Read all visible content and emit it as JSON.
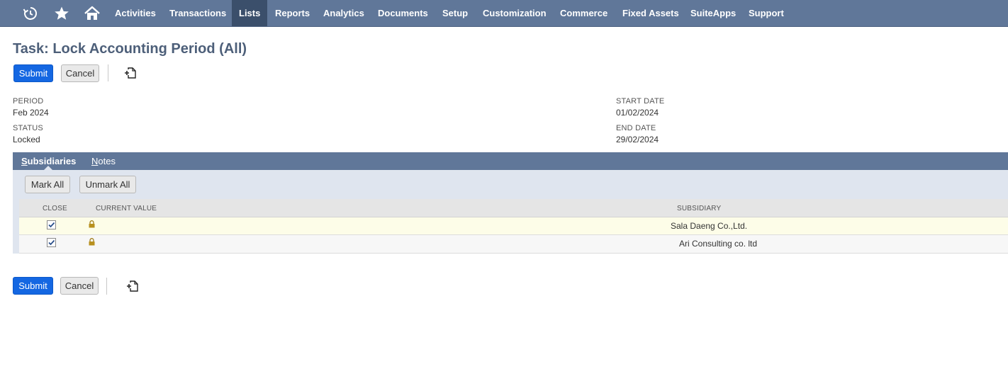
{
  "nav": {
    "items": [
      {
        "label": "Activities",
        "active": false
      },
      {
        "label": "Transactions",
        "active": false
      },
      {
        "label": "Lists",
        "active": true
      },
      {
        "label": "Reports",
        "active": false
      },
      {
        "label": "Analytics",
        "active": false
      },
      {
        "label": "Documents",
        "active": false
      },
      {
        "label": "Setup",
        "active": false
      },
      {
        "label": "Customization",
        "active": false
      },
      {
        "label": "Commerce",
        "active": false
      },
      {
        "label": "Fixed Assets",
        "active": false
      },
      {
        "label": "SuiteApps",
        "active": false
      },
      {
        "label": "Support",
        "active": false
      }
    ],
    "icons": [
      "recent-records-icon",
      "star-icon",
      "home-icon"
    ]
  },
  "page": {
    "title": "Task: Lock Accounting Period (All)"
  },
  "actions": {
    "submit_label": "Submit",
    "cancel_label": "Cancel"
  },
  "fields": {
    "period_label": "PERIOD",
    "period_value": "Feb 2024",
    "status_label": "STATUS",
    "status_value": "Locked",
    "start_date_label": "START DATE",
    "start_date_value": "01/02/2024",
    "end_date_label": "END DATE",
    "end_date_value": "29/02/2024"
  },
  "tabs": {
    "subsidiaries": {
      "underlined": "S",
      "rest": "ubsidiaries"
    },
    "notes": {
      "underlined": "N",
      "rest": "otes"
    }
  },
  "sublist": {
    "mark_all_label": "Mark All",
    "unmark_all_label": "Unmark All",
    "columns": [
      "CLOSE",
      "CURRENT VALUE",
      "SUBSIDIARY"
    ],
    "rows": [
      {
        "close": true,
        "current_value_locked": true,
        "subsidiary": "Sala Daeng Co.,Ltd."
      },
      {
        "close": true,
        "current_value_locked": true,
        "subsidiary": "Ari Consulting co. ltd"
      }
    ]
  },
  "colors": {
    "nav_bg": "#607799",
    "nav_active": "#3b4f6b",
    "primary_button": "#1467e2",
    "title": "#4d5f79"
  }
}
